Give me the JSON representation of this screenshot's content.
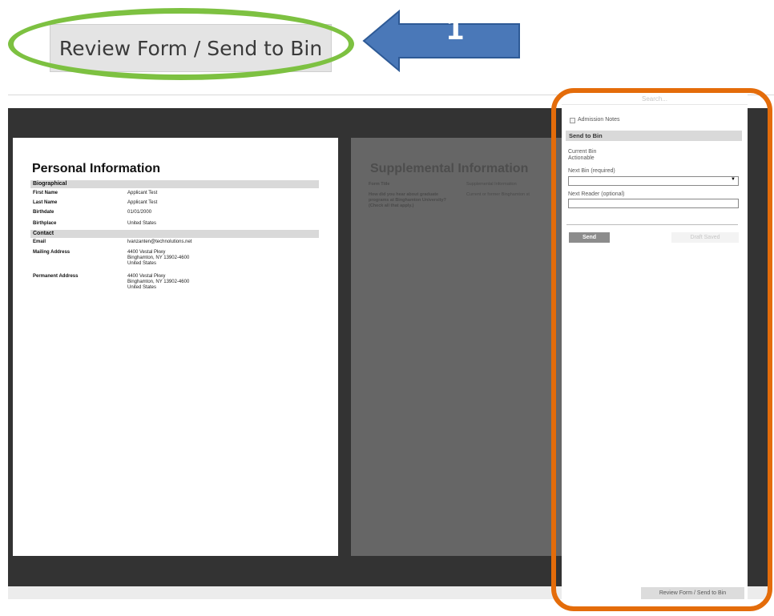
{
  "header": {
    "review_button_label": "Review Form / Send to Bin",
    "step_number": "1",
    "highlight_color": "#7dc141",
    "arrow_color": "#4a78b8",
    "panel_highlight_color": "#e46c0a"
  },
  "personal": {
    "title": "Personal Information",
    "section_biographical": "Biographical",
    "section_contact": "Contact",
    "fields": [
      {
        "label": "First Name",
        "value": "Applicant Test"
      },
      {
        "label": "Last Name",
        "value": "Applicant Test"
      },
      {
        "label": "Birthdate",
        "value": "01/01/2000"
      },
      {
        "label": "Birthplace",
        "value": "United States"
      },
      {
        "label": "Email",
        "value": "lvanzanten@technolutions.net"
      },
      {
        "label": "Mailing Address",
        "value": "4400 Vestal Pkwy\nBinghamton, NY 13902-4600\nUnited States"
      },
      {
        "label": "Permanent Address",
        "value": "4400 Vestal Pkwy\nBinghamton, NY 13902-4600\nUnited States"
      }
    ]
  },
  "supplemental": {
    "title": "Supplemental Information",
    "form_title_label": "Form Title",
    "form_title_value": "Supplemental Information",
    "question_label": "How did you hear about graduate programs at Binghamton University? (Check all that apply.)",
    "question_value": "Current or former Binghamton st"
  },
  "panel": {
    "search_placeholder": "Search...",
    "admission_notes_label": "Admission Notes",
    "send_to_bin_header": "Send to Bin",
    "current_bin_label": "Current Bin",
    "current_bin_value": "Actionable",
    "next_bin_label": "Next Bin (required)",
    "next_bin_value": "",
    "next_reader_label": "Next Reader (optional)",
    "next_reader_value": "",
    "send_button": "Send",
    "draft_saved": "Draft Saved",
    "bottom_tab": "Review Form / Send to Bin"
  }
}
